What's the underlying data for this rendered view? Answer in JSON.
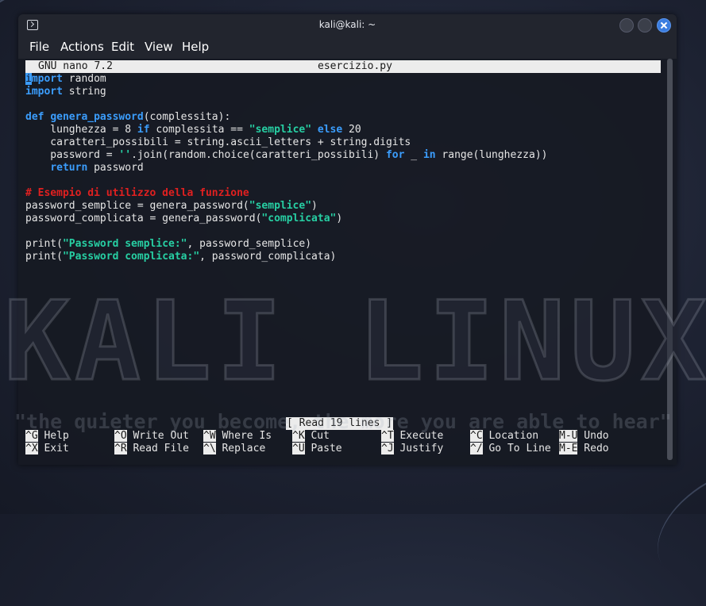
{
  "window": {
    "title": "kali@kali: ~",
    "menu": [
      "File",
      "Actions",
      "Edit",
      "View",
      "Help"
    ]
  },
  "wallpaper": {
    "logo_text": "KALI LINUX",
    "tagline": "\"the quieter you become, the more you are able to hear\""
  },
  "nano": {
    "version": "GNU nano 7.2",
    "filename": "esercizio.py",
    "status_message": "[ Read 19 lines ]",
    "code_lines": [
      [
        {
          "t": "i",
          "c": "cursor"
        },
        {
          "t": "mport",
          "c": "kw"
        },
        {
          "t": " random",
          "c": ""
        }
      ],
      [
        {
          "t": "import",
          "c": "kw"
        },
        {
          "t": " string",
          "c": ""
        }
      ],
      [],
      [
        {
          "t": "def",
          "c": "kw"
        },
        {
          "t": " ",
          "c": ""
        },
        {
          "t": "genera_password",
          "c": "kw"
        },
        {
          "t": "(complessita):",
          "c": ""
        }
      ],
      [
        {
          "t": "    lunghezza = 8 ",
          "c": ""
        },
        {
          "t": "if",
          "c": "kw"
        },
        {
          "t": " complessita == ",
          "c": ""
        },
        {
          "t": "\"semplice\"",
          "c": "str"
        },
        {
          "t": " ",
          "c": ""
        },
        {
          "t": "else",
          "c": "kw"
        },
        {
          "t": " 20",
          "c": ""
        }
      ],
      [
        {
          "t": "    caratteri_possibili = string.ascii_letters + string.digits",
          "c": ""
        }
      ],
      [
        {
          "t": "    password = ",
          "c": ""
        },
        {
          "t": "''",
          "c": "str"
        },
        {
          "t": ".join(random.choice(caratteri_possibili) ",
          "c": ""
        },
        {
          "t": "for",
          "c": "kw"
        },
        {
          "t": " _ ",
          "c": ""
        },
        {
          "t": "in",
          "c": "kw"
        },
        {
          "t": " range(lunghezza))",
          "c": ""
        }
      ],
      [
        {
          "t": "    ",
          "c": ""
        },
        {
          "t": "return",
          "c": "kw"
        },
        {
          "t": " password",
          "c": ""
        }
      ],
      [],
      [
        {
          "t": "# Esempio di utilizzo della funzione",
          "c": "cmt"
        }
      ],
      [
        {
          "t": "password_semplice = genera_password(",
          "c": ""
        },
        {
          "t": "\"semplice\"",
          "c": "str"
        },
        {
          "t": ")",
          "c": ""
        }
      ],
      [
        {
          "t": "password_complicata = genera_password(",
          "c": ""
        },
        {
          "t": "\"complicata\"",
          "c": "str"
        },
        {
          "t": ")",
          "c": ""
        }
      ],
      [],
      [
        {
          "t": "print(",
          "c": ""
        },
        {
          "t": "\"Password semplice:\"",
          "c": "str"
        },
        {
          "t": ", password_semplice)",
          "c": ""
        }
      ],
      [
        {
          "t": "print(",
          "c": ""
        },
        {
          "t": "\"Password complicata:\"",
          "c": "str"
        },
        {
          "t": ", password_complicata)",
          "c": ""
        }
      ]
    ],
    "shortcuts": [
      {
        "key": "^G",
        "label": "Help"
      },
      {
        "key": "^X",
        "label": "Exit"
      },
      {
        "key": "^O",
        "label": "Write Out"
      },
      {
        "key": "^R",
        "label": "Read File"
      },
      {
        "key": "^W",
        "label": "Where Is"
      },
      {
        "key": "^\\",
        "label": "Replace"
      },
      {
        "key": "^K",
        "label": "Cut"
      },
      {
        "key": "^U",
        "label": "Paste"
      },
      {
        "key": "^T",
        "label": "Execute"
      },
      {
        "key": "^J",
        "label": "Justify"
      },
      {
        "key": "^C",
        "label": "Location"
      },
      {
        "key": "^/",
        "label": "Go To Line"
      },
      {
        "key": "M-U",
        "label": "Undo"
      },
      {
        "key": "M-E",
        "label": "Redo"
      }
    ]
  }
}
